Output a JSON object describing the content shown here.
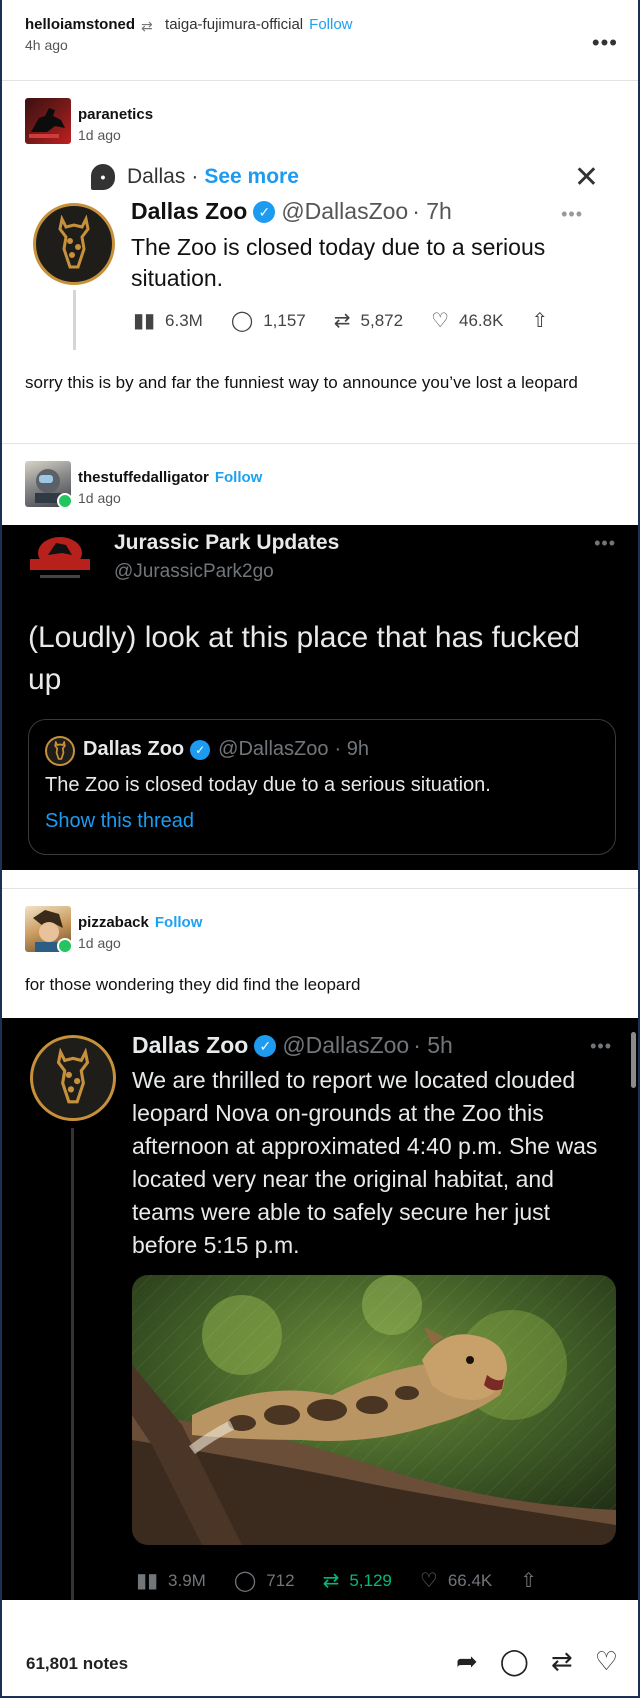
{
  "header": {
    "author": "helloiamstoned",
    "reblogged_from": "taiga-fujimura-official",
    "follow": "Follow",
    "time": "4h ago",
    "more": "•••"
  },
  "posts": [
    {
      "user": "paranetics",
      "time": "1d ago",
      "tweet": {
        "topic": "Dallas",
        "topic_sep": "·",
        "see_more": "See more",
        "close": "✕",
        "name": "Dallas Zoo",
        "handle": "@DallasZoo",
        "age": "· 7h",
        "text": "The Zoo is closed today due to a serious situation.",
        "views": "6.3M",
        "replies": "1,157",
        "retweets": "5,872",
        "likes": "46.8K"
      },
      "caption": "sorry this is by and far the funniest way to announce you’ve lost a leopard"
    },
    {
      "user": "thestuffedalligator",
      "follow": "Follow",
      "time": "1d ago",
      "tweet": {
        "name": "Jurassic Park Updates",
        "handle": "@JurassicPark2go",
        "logo_text": "JURASSIC PARK",
        "text": "(Loudly) look at this place that has fucked up",
        "quote": {
          "name": "Dallas Zoo",
          "handle": "@DallasZoo",
          "age": "· 9h",
          "text": "The Zoo is closed today due to a serious situation.",
          "link": "Show this thread"
        }
      }
    },
    {
      "user": "pizzaback",
      "follow": "Follow",
      "time": "1d ago",
      "caption": "for those wondering they did find the leopard",
      "tweet": {
        "name": "Dallas Zoo",
        "handle": "@DallasZoo",
        "age": "· 5h",
        "text": "We are thrilled to report we located clouded leopard Nova on-grounds at the Zoo this afternoon at approximated 4:40 p.m. She was located very near the original habitat, and teams were able to safely secure her just before 5:15 p.m.",
        "views": "3.9M",
        "replies": "712",
        "retweets": "5,129",
        "likes": "66.4K"
      }
    }
  ],
  "footer": {
    "notes": "61,801 notes"
  },
  "colors": {
    "accent_blue": "#1d9bf0",
    "tumblr_follow": "#1da1f2",
    "retweet_green": "#00ba7c",
    "zoo_gold": "#c6913a"
  }
}
